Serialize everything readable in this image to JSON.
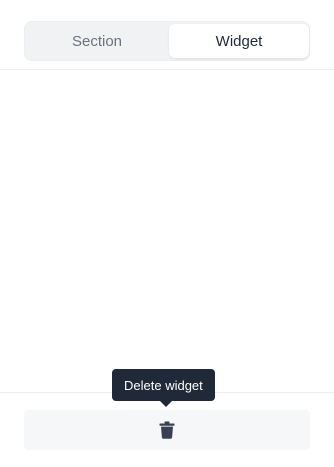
{
  "tabs": {
    "section_label": "Section",
    "widget_label": "Widget",
    "active": "Widget"
  },
  "footer": {
    "delete_icon": "trash-icon",
    "tooltip": "Delete widget"
  },
  "colors": {
    "tooltip_bg": "#1f2937",
    "segmented_bg": "#f1f2f4",
    "active_tab_bg": "#ffffff",
    "delete_button_bg": "#f6f7f8",
    "icon": "#374151"
  }
}
